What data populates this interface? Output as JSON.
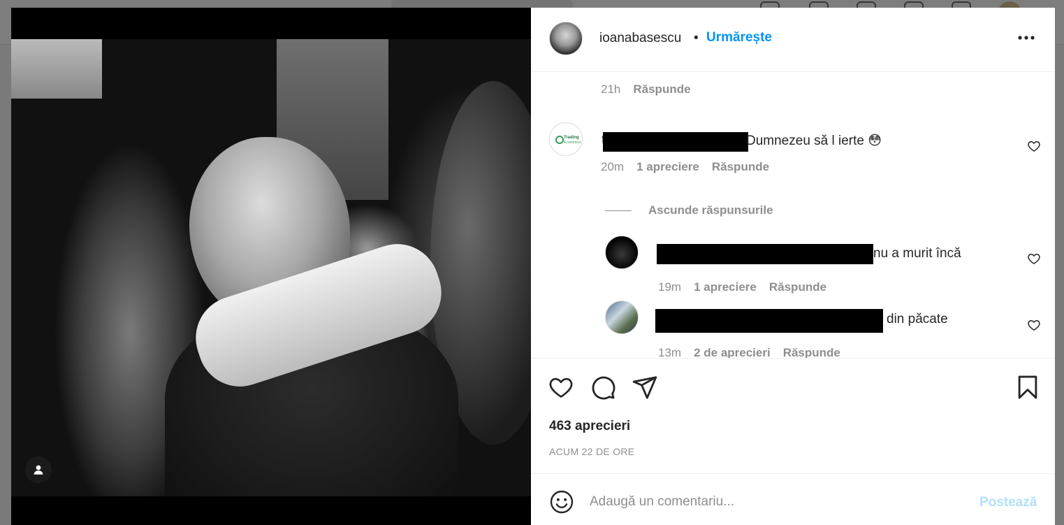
{
  "post": {
    "author": "ioanabasescu",
    "separator": "•",
    "follow_label": "Urmărește",
    "likes_count": "463 aprecieri",
    "timestamp": "ACUM 22 DE ORE"
  },
  "comments": {
    "top_meta": {
      "time": "21h",
      "reply": "Răspunde"
    },
    "main": {
      "text": "Dumnezeu să l ierte 😳",
      "name_prefix": "t",
      "time": "20m",
      "likes": "1 apreciere",
      "reply": "Răspunde"
    },
    "hide_replies_label": "Ascunde răspunsurile",
    "replies": [
      {
        "text": "nu a murit încă",
        "time": "19m",
        "likes": "1 apreciere",
        "reply": "Răspunde"
      },
      {
        "text": "din păcate",
        "time": "13m",
        "likes": "2 de aprecieri",
        "reply": "Răspunde"
      }
    ]
  },
  "comment_box": {
    "placeholder": "Adaugă un comentariu...",
    "post_label": "Postează"
  },
  "icons": {
    "more": "more-options-icon",
    "like": "heart-icon",
    "comment": "comment-icon",
    "share": "send-icon",
    "save": "bookmark-icon",
    "emoji": "emoji-icon",
    "user_tag": "user-tag-icon"
  },
  "colors": {
    "accent": "#0095f6",
    "post_disabled": "#b2dffc",
    "muted": "#8e8e8e",
    "text": "#262626"
  }
}
